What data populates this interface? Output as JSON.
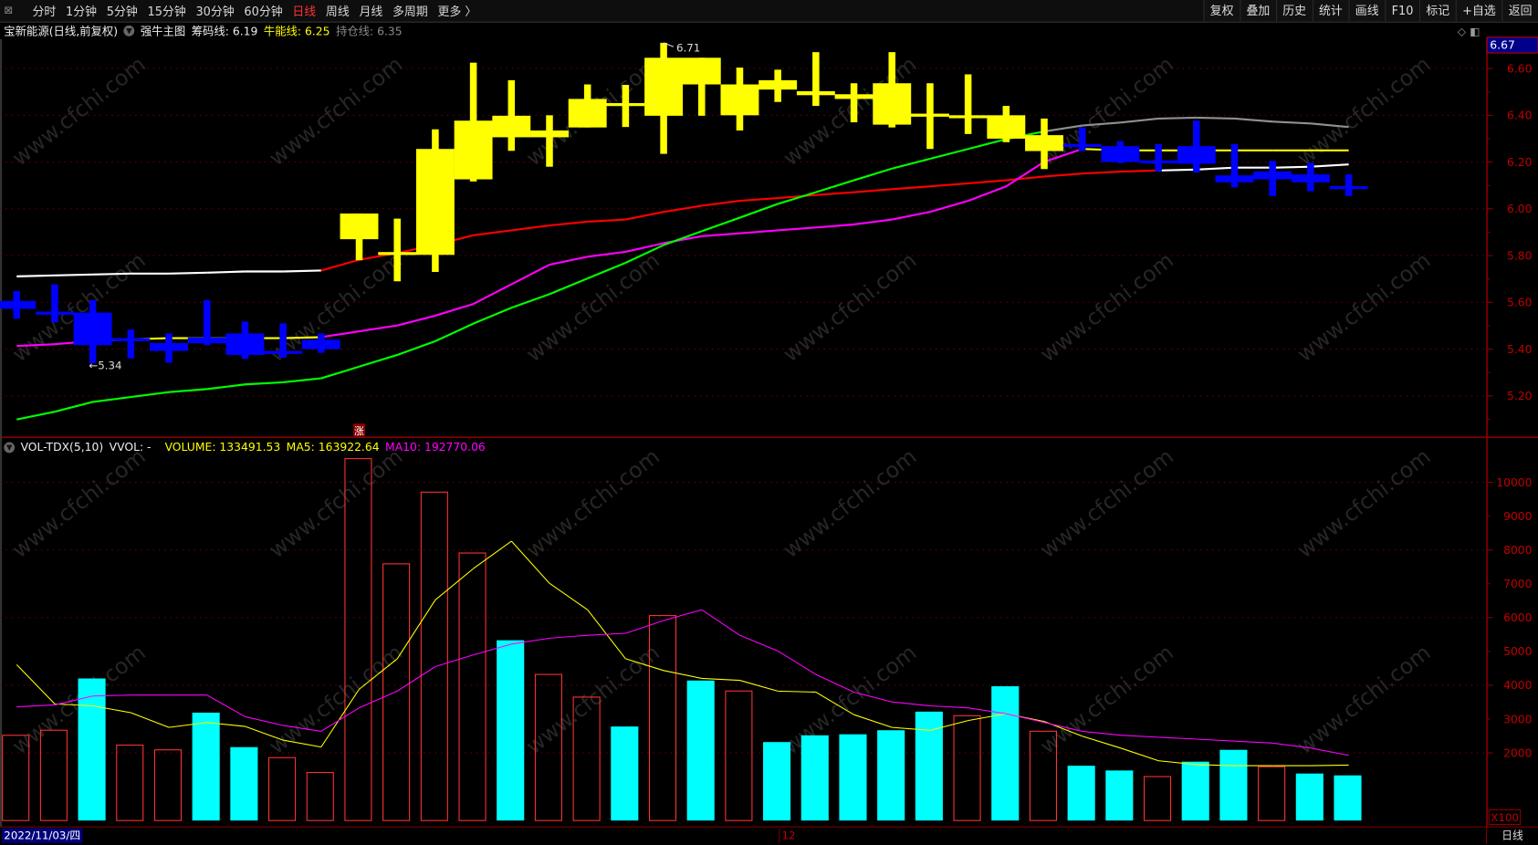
{
  "toolbar": {
    "tabs": [
      {
        "label": "分时"
      },
      {
        "label": "1分钟"
      },
      {
        "label": "5分钟"
      },
      {
        "label": "15分钟"
      },
      {
        "label": "30分钟"
      },
      {
        "label": "60分钟"
      },
      {
        "label": "日线",
        "active": true
      },
      {
        "label": "周线"
      },
      {
        "label": "月线"
      },
      {
        "label": "多周期"
      },
      {
        "label": "更多 〉"
      }
    ],
    "buttons": [
      "复权",
      "叠加",
      "历史",
      "统计",
      "画线",
      "F10",
      "标记",
      "+自选",
      "返回"
    ]
  },
  "info": {
    "title": "宝新能源(日线,前复权)",
    "indicator": "强牛主图",
    "chouma": "筹码线: 6.19",
    "niuneng": "牛能线: 6.25",
    "chicang": "持仓线: 6.35"
  },
  "volume_legend": {
    "name": "VOL-TDX(5,10)",
    "vvol": "VVOL: -",
    "volume": "VOLUME: 133491.53",
    "ma5": "MA5: 163922.64",
    "ma10": "MA10: 192770.06"
  },
  "bottom": {
    "date": "2022/11/03/四",
    "month_tick": "12",
    "period": "日线"
  },
  "watermark": "www.cfchi.com",
  "colors": {
    "up_candle": "#ffff00",
    "down_candle": "#0000ff",
    "vol_up": "#ff3232",
    "vol_down": "#00ffff",
    "axis": "#c00000",
    "chouma_above": "#ff0000",
    "chouma_below": "#ffffff",
    "niuneng_a": "#ff00ff",
    "niuneng_b": "#ffff00",
    "chicang_a": "#00ff00",
    "chicang_b": "#909090"
  },
  "chart_data": [
    {
      "type": "candlestick",
      "ylim": [
        5.05,
        6.75
      ],
      "yticks": [
        "6.60",
        "6.40",
        "6.20",
        "6.00",
        "5.80",
        "5.60",
        "5.40",
        "5.20"
      ],
      "current_price_tag": "6.67",
      "annotations": {
        "low": "←5.34",
        "high": "6.71",
        "signal": "涨"
      },
      "candle_colors": [
        "blue",
        "blue",
        "blue",
        "blue",
        "blue",
        "blue",
        "blue",
        "blue",
        "blue",
        "yellow",
        "yellow",
        "yellow",
        "yellow",
        "yellow",
        "yellow",
        "yellow",
        "yellow",
        "yellow",
        "yellow",
        "yellow",
        "yellow",
        "yellow",
        "yellow",
        "yellow",
        "yellow",
        "yellow",
        "yellow",
        "yellow",
        "blue",
        "blue",
        "blue",
        "blue",
        "blue",
        "blue",
        "blue",
        "blue"
      ],
      "ohlc": [
        [
          5.606,
          5.648,
          5.53,
          5.572
        ],
        [
          5.56,
          5.677,
          5.514,
          5.547
        ],
        [
          5.556,
          5.61,
          5.34,
          5.417
        ],
        [
          5.447,
          5.484,
          5.36,
          5.434
        ],
        [
          5.426,
          5.467,
          5.342,
          5.392
        ],
        [
          5.45,
          5.61,
          5.417,
          5.425
        ],
        [
          5.467,
          5.518,
          5.358,
          5.375
        ],
        [
          5.392,
          5.51,
          5.363,
          5.38
        ],
        [
          5.44,
          5.467,
          5.384,
          5.4
        ],
        [
          5.87,
          5.98,
          5.78,
          5.98
        ],
        [
          5.807,
          5.958,
          5.69,
          5.815
        ],
        [
          5.803,
          6.34,
          5.73,
          6.256
        ],
        [
          6.126,
          6.625,
          6.117,
          6.377
        ],
        [
          6.306,
          6.55,
          6.248,
          6.398
        ],
        [
          6.306,
          6.4,
          6.18,
          6.335
        ],
        [
          6.348,
          6.532,
          6.348,
          6.47
        ],
        [
          6.448,
          6.53,
          6.35,
          6.452
        ],
        [
          6.398,
          6.71,
          6.235,
          6.646
        ],
        [
          6.532,
          6.646,
          6.398,
          6.646
        ],
        [
          6.4,
          6.604,
          6.335,
          6.532
        ],
        [
          6.51,
          6.595,
          6.457,
          6.55
        ],
        [
          6.486,
          6.67,
          6.44,
          6.503
        ],
        [
          6.47,
          6.537,
          6.37,
          6.49
        ],
        [
          6.36,
          6.67,
          6.348,
          6.537
        ],
        [
          6.394,
          6.537,
          6.256,
          6.407
        ],
        [
          6.398,
          6.575,
          6.32,
          6.4
        ],
        [
          6.3,
          6.44,
          6.285,
          6.4
        ],
        [
          6.247,
          6.386,
          6.17,
          6.315
        ],
        [
          6.277,
          6.348,
          6.247,
          6.275
        ],
        [
          6.268,
          6.289,
          6.195,
          6.2
        ],
        [
          6.207,
          6.277,
          6.16,
          6.203
        ],
        [
          6.268,
          6.377,
          6.155,
          6.193
        ],
        [
          6.143,
          6.277,
          6.092,
          6.113
        ],
        [
          6.16,
          6.205,
          6.055,
          6.126
        ],
        [
          6.147,
          6.197,
          6.075,
          6.113
        ],
        [
          6.097,
          6.147,
          6.055,
          6.096
        ]
      ],
      "series": [
        {
          "name": "筹码线",
          "values": [
            5.711,
            5.715,
            5.719,
            5.723,
            5.723,
            5.727,
            5.732,
            5.732,
            5.736,
            5.782,
            5.811,
            5.845,
            5.887,
            5.908,
            5.929,
            5.945,
            5.954,
            5.987,
            6.013,
            6.034,
            6.046,
            6.059,
            6.071,
            6.084,
            6.096,
            6.109,
            6.122,
            6.138,
            6.151,
            6.159,
            6.164,
            6.168,
            6.176,
            6.176,
            6.18,
            6.19
          ],
          "colors": [
            "b",
            "b",
            "b",
            "b",
            "b",
            "b",
            "b",
            "b",
            "b",
            "a",
            "a",
            "a",
            "a",
            "a",
            "a",
            "a",
            "a",
            "a",
            "a",
            "a",
            "a",
            "a",
            "a",
            "a",
            "a",
            "a",
            "a",
            "a",
            "a",
            "a",
            "a",
            "b",
            "b",
            "b",
            "b",
            "b"
          ]
        },
        {
          "name": "牛能线",
          "values": [
            5.413,
            5.421,
            5.434,
            5.442,
            5.447,
            5.447,
            5.447,
            5.447,
            5.451,
            5.476,
            5.501,
            5.543,
            5.593,
            5.677,
            5.761,
            5.795,
            5.816,
            5.853,
            5.883,
            5.895,
            5.908,
            5.92,
            5.933,
            5.954,
            5.987,
            6.034,
            6.096,
            6.201,
            6.256,
            6.25,
            6.25,
            6.25,
            6.25,
            6.25,
            6.25,
            6.25
          ],
          "colors": [
            "a",
            "a",
            "a",
            "b",
            "b",
            "b",
            "b",
            "b",
            "b",
            "a",
            "a",
            "a",
            "a",
            "a",
            "a",
            "a",
            "a",
            "a",
            "a",
            "a",
            "a",
            "a",
            "a",
            "a",
            "a",
            "a",
            "a",
            "a",
            "a",
            "b",
            "b",
            "b",
            "b",
            "b",
            "b",
            "b"
          ]
        },
        {
          "name": "持仓线",
          "values": [
            5.099,
            5.132,
            5.174,
            5.195,
            5.216,
            5.229,
            5.249,
            5.258,
            5.275,
            5.325,
            5.375,
            5.434,
            5.509,
            5.577,
            5.635,
            5.702,
            5.769,
            5.845,
            5.904,
            5.962,
            6.021,
            6.071,
            6.122,
            6.172,
            6.214,
            6.256,
            6.298,
            6.331,
            6.356,
            6.369,
            6.386,
            6.39,
            6.386,
            6.373,
            6.365,
            6.35
          ],
          "colors": [
            "a",
            "a",
            "a",
            "a",
            "a",
            "a",
            "a",
            "a",
            "a",
            "a",
            "a",
            "a",
            "a",
            "a",
            "a",
            "a",
            "a",
            "a",
            "a",
            "a",
            "a",
            "a",
            "a",
            "a",
            "a",
            "a",
            "a",
            "a",
            "b",
            "b",
            "b",
            "b",
            "b",
            "b",
            "b",
            "b"
          ]
        }
      ]
    },
    {
      "type": "bar",
      "unit": "X100",
      "ylim": [
        0,
        11000
      ],
      "yticks": [
        "10000",
        "9000",
        "8000",
        "7000",
        "6000",
        "5000",
        "4000",
        "3000",
        "2000"
      ],
      "values": [
        2520,
        2670,
        4200,
        2230,
        2090,
        3190,
        2170,
        1860,
        1420,
        10700,
        7590,
        9710,
        7910,
        5330,
        4320,
        3650,
        2780,
        6060,
        4140,
        3830,
        2320,
        2520,
        2550,
        2670,
        3220,
        3100,
        3970,
        2640,
        1620,
        1480,
        1300,
        1740,
        2090,
        1590,
        1390,
        1335
      ],
      "up": [
        true,
        true,
        false,
        true,
        true,
        false,
        false,
        true,
        true,
        true,
        true,
        true,
        true,
        false,
        true,
        true,
        false,
        true,
        false,
        true,
        false,
        false,
        false,
        false,
        false,
        true,
        false,
        true,
        false,
        false,
        true,
        false,
        false,
        true,
        false,
        false
      ],
      "series": [
        {
          "name": "MA5",
          "values": [
            4609,
            3449,
            3391,
            3188,
            2754,
            2899,
            2783,
            2377,
            2174,
            3884,
            4783,
            6522,
            7449,
            8261,
            7014,
            6232,
            4783,
            4435,
            4203,
            4145,
            3826,
            3797,
            3130,
            2754,
            2667,
            2957,
            3159,
            2928,
            2493,
            2145,
            1768,
            1652,
            1623,
            1623,
            1623,
            1639
          ]
        },
        {
          "name": "MA10",
          "values": [
            3362,
            3420,
            3681,
            3710,
            3710,
            3710,
            3072,
            2812,
            2638,
            3333,
            3826,
            4551,
            4899,
            5217,
            5391,
            5478,
            5536,
            5913,
            6232,
            5478,
            5014,
            4319,
            3797,
            3507,
            3391,
            3333,
            3159,
            2899,
            2638,
            2522,
            2464,
            2406,
            2348,
            2290,
            2145,
            1928
          ]
        }
      ]
    }
  ]
}
